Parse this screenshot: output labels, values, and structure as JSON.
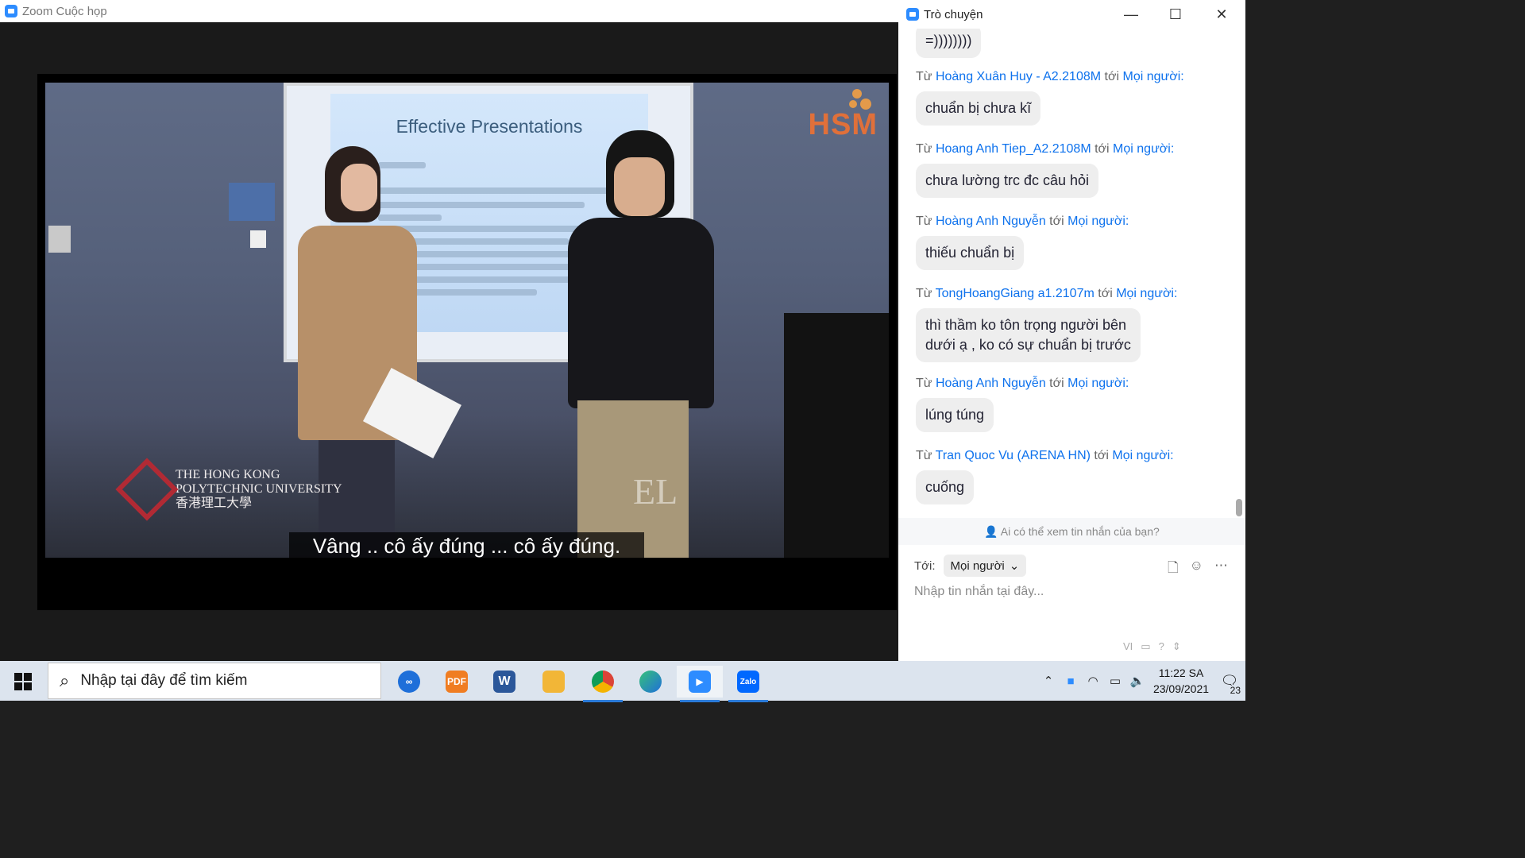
{
  "zoom": {
    "title": "Zoom Cuộc họp"
  },
  "video": {
    "slide_title": "Effective Presentations",
    "hsm_logo": "HSM",
    "university_logo": "THE HONG KONG\nPOLYTECHNIC UNIVERSITY\n香港理工大學",
    "subtitle": "Vâng .. cô ấy đúng ... cô ấy đúng."
  },
  "chat": {
    "title": "Trò chuyện",
    "window_controls": {
      "minimize": "—",
      "maximize": "☐",
      "close": "✕"
    },
    "truncated_bubble": "=))))))))",
    "messages": [
      {
        "prefix": "Từ",
        "sender": "Hoàng Xuân Huy - A2.2108M",
        "mid": "tới",
        "recipient": "Mọi người:",
        "text": "chuẩn bị chưa kĩ"
      },
      {
        "prefix": "Từ",
        "sender": "Hoang Anh Tiep_A2.2108M",
        "mid": "tới",
        "recipient": "Mọi người:",
        "text": "chưa lường trc đc câu hỏi"
      },
      {
        "prefix": "Từ",
        "sender": "Hoàng Anh Nguyễn",
        "mid": "tới",
        "recipient": "Mọi người:",
        "text": "thiếu chuẩn bị"
      },
      {
        "prefix": "Từ",
        "sender": "TongHoangGiang a1.2107m",
        "mid": "tới",
        "recipient": "Mọi người:",
        "text": "thì thầm ko tôn trọng người bên\ndưới ạ , ko có sự chuẩn bị trước"
      },
      {
        "prefix": "Từ",
        "sender": "Hoàng Anh Nguyễn",
        "mid": "tới",
        "recipient": "Mọi người:",
        "text": "lúng túng"
      },
      {
        "prefix": "Từ",
        "sender": "Tran Quoc Vu (ARENA HN)",
        "mid": "tới",
        "recipient": "Mọi người:",
        "text": "cuống"
      }
    ],
    "who_can_see": "Ai có thể xem tin nhắn của bạn?",
    "to_label": "Tới:",
    "to_value": "Mọi người",
    "input_placeholder": "Nhập tin nhắn tại đây...",
    "ime_label": "VI"
  },
  "taskbar": {
    "search_placeholder": "Nhập tại đây để tìm kiếm",
    "apps": [
      {
        "name": "link",
        "label": "",
        "color": "#1e6fd9"
      },
      {
        "name": "pdf",
        "label": "PDF",
        "color": "#f07d22"
      },
      {
        "name": "word",
        "label": "W",
        "color": "#2b579a"
      },
      {
        "name": "explorer",
        "label": "",
        "color": "#f2b637"
      },
      {
        "name": "chrome",
        "label": "",
        "color": "#2fa84f"
      },
      {
        "name": "edge",
        "label": "",
        "color": "#1f9edb"
      },
      {
        "name": "zoom",
        "label": "",
        "color": "#2d8cff"
      },
      {
        "name": "zalo",
        "label": "Zalo",
        "color": "#0068ff"
      }
    ],
    "time": "11:22 SA",
    "date": "23/09/2021",
    "notification_count": "23"
  }
}
